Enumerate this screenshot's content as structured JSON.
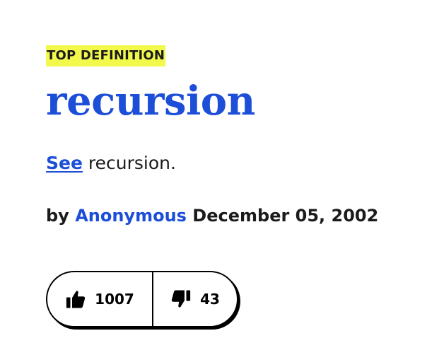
{
  "definition": {
    "badge": "TOP DEFINITION",
    "word": "recursion",
    "meaning_link": "See",
    "meaning_rest": " recursion.",
    "by_label": "by",
    "author": "Anonymous",
    "date": "December 05, 2002"
  },
  "votes": {
    "up_count": "1007",
    "down_count": "43",
    "up_icon": "thumbs-up-icon",
    "down_icon": "thumbs-down-icon"
  },
  "colors": {
    "link": "#1d4ed8",
    "badge_bg": "#f2f94b",
    "text": "#1b1b1b"
  }
}
